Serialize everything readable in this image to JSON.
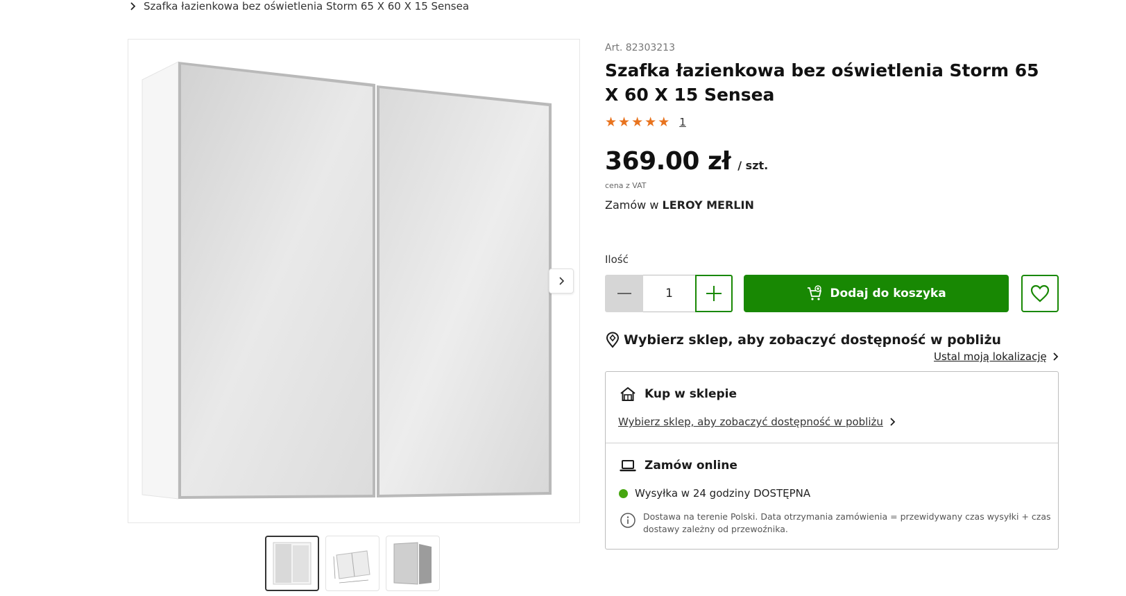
{
  "breadcrumb": {
    "current": "Szafka łazienkowa bez oświetlenia Storm 65 X 60 X 15 Sensea"
  },
  "product": {
    "art": "Art. 82303213",
    "title": "Szafka łazienkowa bez oświetlenia Storm 65 X 60 X 15 Sensea",
    "rating": {
      "stars": 5,
      "max": 5,
      "count": "1"
    },
    "price": "369.00 zł",
    "unit": "/ szt.",
    "vat": "cena z VAT",
    "order_prefix": "Zamów w",
    "store_brand": "LEROY MERLIN"
  },
  "gallery": {
    "thumbnails": 3,
    "active_index": 0
  },
  "quantity": {
    "label": "Ilość",
    "value": "1"
  },
  "cart": {
    "add_label": "Dodaj do koszyka"
  },
  "availability": {
    "store_prompt": "Wybierz sklep, aby zobaczyć dostępność w pobliżu",
    "locate_link": "Ustal moją lokalizację",
    "buy_in_store": {
      "heading": "Kup w sklepie",
      "link": "Wybierz sklep, aby zobaczyć dostępność w pobliżu"
    },
    "order_online": {
      "heading": "Zamów online",
      "shipping": "Wysyłka w 24 godziny DOSTĘPNA",
      "note": "Dostawa na terenie Polski. Data otrzymania zamówienia = przewidywany czas wysyłki + czas dostawy zależny od przewoźnika."
    }
  },
  "colors": {
    "brand_green": "#188803",
    "star": "#e8731e",
    "available_dot": "#46a610"
  },
  "icons": [
    "chevron-right-icon",
    "minus-icon",
    "plus-icon",
    "cart-icon",
    "heart-icon",
    "location-pin-icon",
    "store-icon",
    "laptop-icon",
    "info-icon"
  ]
}
